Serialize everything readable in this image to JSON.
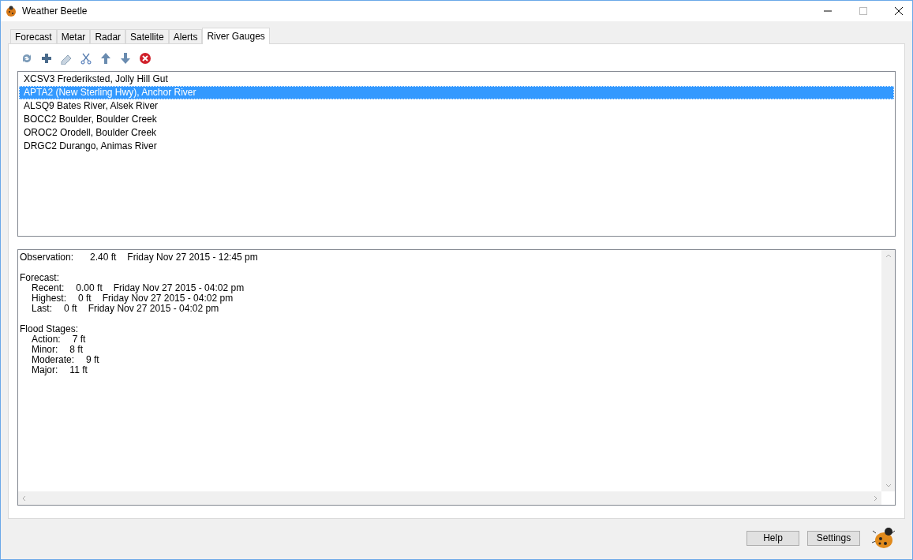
{
  "window": {
    "title": "Weather Beetle"
  },
  "tabs": [
    {
      "label": "Forecast",
      "selected": false
    },
    {
      "label": "Metar",
      "selected": false
    },
    {
      "label": "Radar",
      "selected": false
    },
    {
      "label": "Satellite",
      "selected": false
    },
    {
      "label": "Alerts",
      "selected": false
    },
    {
      "label": "River Gauges",
      "selected": true
    }
  ],
  "stations": [
    {
      "label": "XCSV3 Frederiksted, Jolly Hill Gut",
      "selected": false
    },
    {
      "label": "APTA2 (New Sterling Hwy), Anchor River",
      "selected": true
    },
    {
      "label": "ALSQ9 Bates River, Alsek River",
      "selected": false
    },
    {
      "label": "BOCC2 Boulder, Boulder Creek",
      "selected": false
    },
    {
      "label": "OROC2 Orodell, Boulder Creek",
      "selected": false
    },
    {
      "label": "DRGC2 Durango, Animas River",
      "selected": false
    }
  ],
  "observation": {
    "label": "Observation:",
    "value": "2.40 ft",
    "time": "Friday Nov 27 2015 - 12:45 pm"
  },
  "forecast": {
    "heading": "Forecast:",
    "rows": [
      {
        "label": "Recent:",
        "value": "0.00 ft",
        "time": "Friday Nov 27 2015 - 04:02 pm"
      },
      {
        "label": "Highest:",
        "value": "0 ft",
        "time": "Friday Nov 27 2015 - 04:02 pm"
      },
      {
        "label": "Last:",
        "value": "0 ft",
        "time": "Friday Nov 27 2015 - 04:02 pm"
      }
    ]
  },
  "flood_stages": {
    "heading": "Flood Stages:",
    "rows": [
      {
        "label": "Action:",
        "value": "7 ft"
      },
      {
        "label": "Minor:",
        "value": "8 ft"
      },
      {
        "label": "Moderate:",
        "value": "9 ft"
      },
      {
        "label": "Major:",
        "value": "11 ft"
      }
    ]
  },
  "buttons": [
    "Help",
    "Settings"
  ]
}
